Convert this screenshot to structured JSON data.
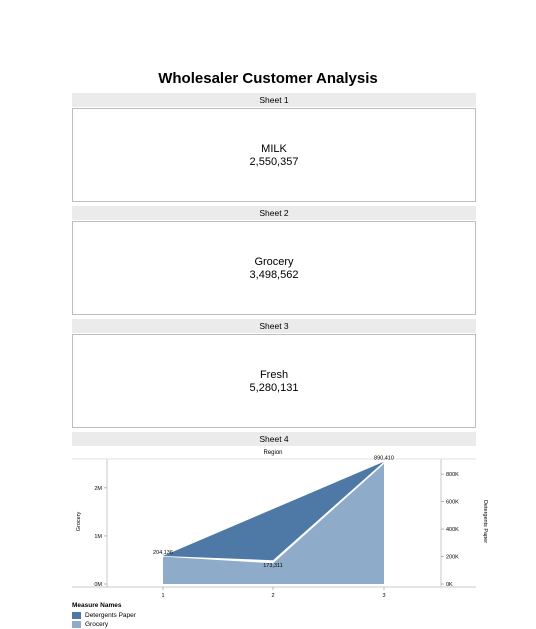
{
  "page": {
    "title": "Wholesaler Customer Analysis"
  },
  "sheets": [
    {
      "header": "Sheet 1",
      "name": "MILK",
      "value": "2,550,357"
    },
    {
      "header": "Sheet 2",
      "name": "Grocery",
      "value": "3,498,562"
    },
    {
      "header": "Sheet 3",
      "name": "Fresh",
      "value": "5,280,131"
    }
  ],
  "sheet4": {
    "header": "Sheet 4"
  },
  "colors": {
    "detergents": "#4e79a7",
    "grocery": "#8eabc9",
    "header_bg": "#ebebeb"
  },
  "chart_data": {
    "type": "area",
    "title": "Region",
    "x": [
      1,
      2,
      3
    ],
    "x_ticks": [
      "1",
      "2",
      "3"
    ],
    "ylabel": "Grocery",
    "y2label": "Detergents Paper",
    "ylim": [
      0,
      2600000
    ],
    "y_ticks": [
      "0M",
      "1M",
      "2M"
    ],
    "y2lim": [
      0,
      910000
    ],
    "y2_ticks": [
      "0K",
      "200K",
      "400K",
      "600K",
      "800K"
    ],
    "series": [
      {
        "name": "Detergents Paper",
        "axis": "right",
        "values": [
          204136,
          173311,
          890410
        ],
        "labels": [
          "204,136",
          "173,311",
          "890,410"
        ]
      },
      {
        "name": "Grocery",
        "axis": "left",
        "values": [
          570000,
          430000,
          2500000
        ]
      }
    ],
    "legend": {
      "title": "Measure Names",
      "position": "bottom-left"
    }
  }
}
